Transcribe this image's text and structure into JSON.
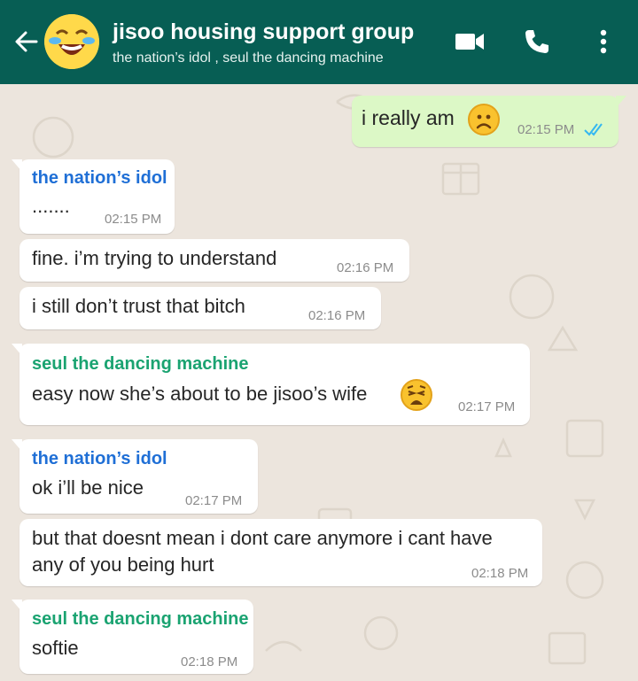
{
  "header": {
    "title": "jisoo housing support group",
    "subtitle": "the nation’s idol , seul the dancing machine",
    "icons": [
      "back-arrow-icon",
      "group-avatar",
      "video-call-icon",
      "phone-call-icon",
      "more-options-icon"
    ]
  },
  "colors": {
    "header": "#075e54",
    "background": "#ece5dd",
    "incoming_bubble": "#ffffff",
    "outgoing_bubble": "#dcf8c6",
    "sender_idol": "#1f6fd6",
    "sender_seul": "#1aa371",
    "read_ticks": "#34b7f1"
  },
  "messages": [
    {
      "direction": "out",
      "text": "i really am",
      "emoji": "frowning-face-emoji",
      "time": "02:15 PM",
      "status": "read-ticks-icon"
    },
    {
      "direction": "in",
      "sender": "the nation’s idol",
      "text": ".......",
      "time": "02:15 PM"
    },
    {
      "direction": "in",
      "text": "fine. i’m trying to understand",
      "time": "02:16 PM"
    },
    {
      "direction": "in",
      "text": "i still don’t trust that bitch",
      "time": "02:16 PM"
    },
    {
      "direction": "in",
      "sender": "seul the dancing machine",
      "text": "easy now she’s about to be jisoo’s wife",
      "emoji": "weary-face-emoji",
      "time": "02:17 PM"
    },
    {
      "direction": "in",
      "sender": "the nation’s idol",
      "text": "ok i’ll be nice",
      "time": "02:17 PM"
    },
    {
      "direction": "in",
      "text_lines": [
        "but that doesnt mean i dont care anymore i cant have",
        "any of you being hurt"
      ],
      "time": "02:18 PM"
    },
    {
      "direction": "in",
      "sender": "seul the dancing machine",
      "text": "softie",
      "time": "02:18 PM"
    }
  ]
}
